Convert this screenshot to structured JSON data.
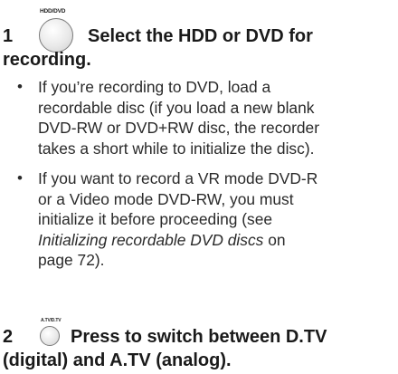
{
  "step1": {
    "button_label": "HDD/DVD",
    "number": "1",
    "title_line1": "Select the HDD or DVD for",
    "title_line2": "recording."
  },
  "bullets": [
    {
      "lines": [
        "If you’re recording to DVD, load a",
        "recordable disc (if you load a new blank",
        "DVD-RW or DVD+RW disc, the recorder",
        "takes a short while to initialize the disc)."
      ]
    },
    {
      "lines": [
        "If you want to record a VR mode DVD-R",
        "or a Video mode DVD-RW, you must",
        "initialize it before proceeding (see"
      ],
      "link_text": "Initializing recordable DVD discs",
      "link_suffix": " on",
      "last_line": "page 72)."
    }
  ],
  "bullet_glyph": "•",
  "step2": {
    "button_label": "A.TV/D.TV",
    "number": "2",
    "title_line1": "Press to switch between D.TV",
    "title_line2": "(digital) and A.TV (analog)."
  }
}
